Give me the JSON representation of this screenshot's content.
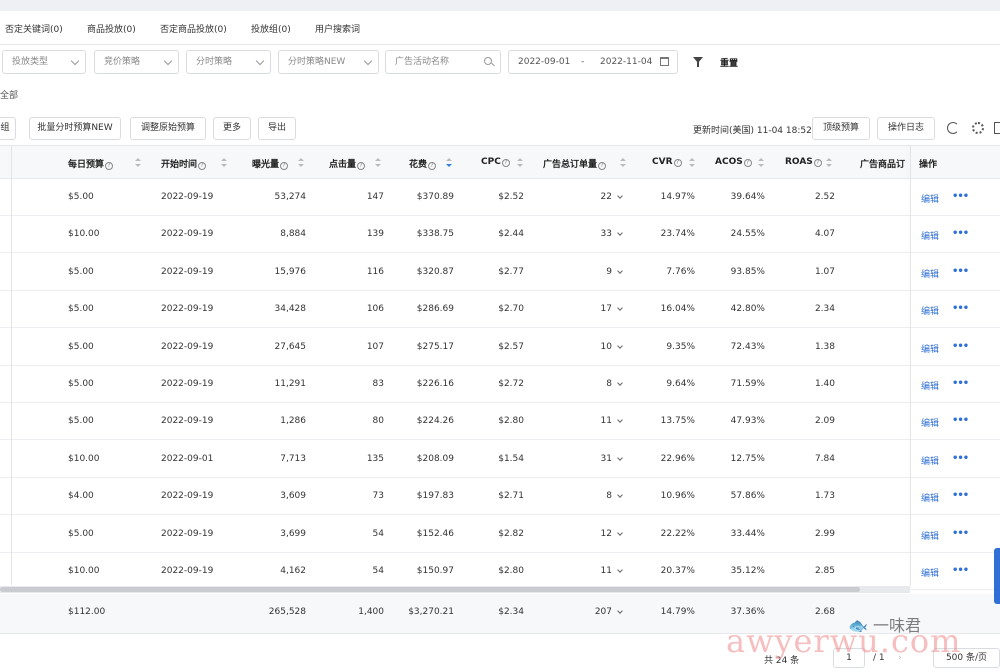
{
  "tabs": [
    "否定关键词(0)",
    "商品投放(0)",
    "否定商品投放(0)",
    "投放组(0)",
    "用户搜索词"
  ],
  "filters": {
    "launch_type": "投放类型",
    "bid_strategy": "竞价策略",
    "time_strategy": "分时策略",
    "time_strategy_new": "分时策略NEW",
    "search_placeholder": "广告活动名称",
    "date_start": "2022-09-01",
    "date_sep": "-",
    "date_end": "2022-11-04",
    "reset": "重置",
    "select_all": "全部"
  },
  "toolbar": {
    "group_fragment": "组",
    "batch_budget": "批量分时预算NEW",
    "adjust_budget": "调整原始预算",
    "more": "更多",
    "export": "导出",
    "updated": "更新时间(美国) 11-04 18:52",
    "top_budget": "顶级预算",
    "op_log": "操作日志"
  },
  "columns": {
    "daily_budget": "每日预算",
    "start_time": "开始时间",
    "impressions": "曝光量",
    "clicks": "点击量",
    "spend": "花费",
    "cpc": "CPC",
    "orders": "广告总订单量",
    "cvr": "CVR",
    "acos": "ACOS",
    "roas": "ROAS",
    "product_orders": "广告商品订",
    "actions": "操作"
  },
  "rows": [
    {
      "budget": "$5.00",
      "start": "2022-09-19",
      "impr": "53,274",
      "clicks": "147",
      "spend": "$370.89",
      "cpc": "$2.52",
      "orders": "22",
      "cvr": "14.97%",
      "acos": "39.64%",
      "roas": "2.52"
    },
    {
      "budget": "$10.00",
      "start": "2022-09-19",
      "impr": "8,884",
      "clicks": "139",
      "spend": "$338.75",
      "cpc": "$2.44",
      "orders": "33",
      "cvr": "23.74%",
      "acos": "24.55%",
      "roas": "4.07"
    },
    {
      "budget": "$5.00",
      "start": "2022-09-19",
      "impr": "15,976",
      "clicks": "116",
      "spend": "$320.87",
      "cpc": "$2.77",
      "orders": "9",
      "cvr": "7.76%",
      "acos": "93.85%",
      "roas": "1.07"
    },
    {
      "budget": "$5.00",
      "start": "2022-09-19",
      "impr": "34,428",
      "clicks": "106",
      "spend": "$286.69",
      "cpc": "$2.70",
      "orders": "17",
      "cvr": "16.04%",
      "acos": "42.80%",
      "roas": "2.34"
    },
    {
      "budget": "$5.00",
      "start": "2022-09-19",
      "impr": "27,645",
      "clicks": "107",
      "spend": "$275.17",
      "cpc": "$2.57",
      "orders": "10",
      "cvr": "9.35%",
      "acos": "72.43%",
      "roas": "1.38"
    },
    {
      "budget": "$5.00",
      "start": "2022-09-19",
      "impr": "11,291",
      "clicks": "83",
      "spend": "$226.16",
      "cpc": "$2.72",
      "orders": "8",
      "cvr": "9.64%",
      "acos": "71.59%",
      "roas": "1.40"
    },
    {
      "budget": "$5.00",
      "start": "2022-09-19",
      "impr": "1,286",
      "clicks": "80",
      "spend": "$224.26",
      "cpc": "$2.80",
      "orders": "11",
      "cvr": "13.75%",
      "acos": "47.93%",
      "roas": "2.09"
    },
    {
      "budget": "$10.00",
      "start": "2022-09-01",
      "impr": "7,713",
      "clicks": "135",
      "spend": "$208.09",
      "cpc": "$1.54",
      "orders": "31",
      "cvr": "22.96%",
      "acos": "12.75%",
      "roas": "7.84"
    },
    {
      "budget": "$4.00",
      "start": "2022-09-19",
      "impr": "3,609",
      "clicks": "73",
      "spend": "$197.83",
      "cpc": "$2.71",
      "orders": "8",
      "cvr": "10.96%",
      "acos": "57.86%",
      "roas": "1.73"
    },
    {
      "budget": "$5.00",
      "start": "2022-09-19",
      "impr": "3,699",
      "clicks": "54",
      "spend": "$152.46",
      "cpc": "$2.82",
      "orders": "12",
      "cvr": "22.22%",
      "acos": "33.44%",
      "roas": "2.99"
    },
    {
      "budget": "$10.00",
      "start": "2022-09-19",
      "impr": "4,162",
      "clicks": "54",
      "spend": "$150.97",
      "cpc": "$2.80",
      "orders": "11",
      "cvr": "20.37%",
      "acos": "35.12%",
      "roas": "2.85"
    }
  ],
  "row_actions": {
    "edit": "编辑",
    "more": "•••"
  },
  "totals": {
    "budget": "$112.00",
    "impr": "265,528",
    "clicks": "1,400",
    "spend": "$3,270.21",
    "cpc": "$2.34",
    "orders": "207",
    "cvr": "14.79%",
    "acos": "37.36%",
    "roas": "2.68"
  },
  "footer": {
    "total_count": "共 24 条",
    "page": "1",
    "pages": "/ 1",
    "page_size": "500 条/页"
  },
  "watermark": {
    "text": "awyerwu.com",
    "brand": "一味君"
  },
  "colors": {
    "link": "#2f6fd6",
    "sort_active": "#3b7ddd",
    "header_bg": "#f7f8fa"
  }
}
